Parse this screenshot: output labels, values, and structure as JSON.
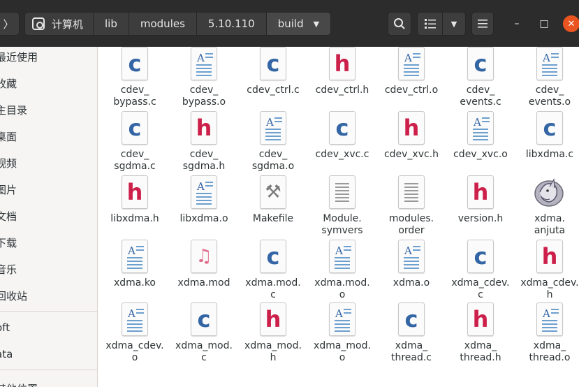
{
  "header": {
    "back_glyph": "〉",
    "breadcrumbs": [
      "计算机",
      "lib",
      "modules",
      "5.10.110",
      "build"
    ],
    "search_icon": "search-icon",
    "view_icon": "list-view-icon",
    "menu_icon": "hamburger-menu-icon",
    "window_controls": {
      "minimize": "–",
      "maximize": "□",
      "close": "✕"
    },
    "colors": {
      "bar": "#2c2c2c",
      "close": "#e95420"
    }
  },
  "sidebar": {
    "items": [
      "最近使用",
      "收藏",
      "主目录",
      "桌面",
      "视频",
      "图片",
      "文档",
      "下载",
      "音乐",
      "回收站",
      "oft",
      "ata",
      "其他位置"
    ]
  },
  "files": [
    {
      "label": "cdev_\nbypass.c",
      "type": "c"
    },
    {
      "label": "cdev_\nbypass.o",
      "type": "o"
    },
    {
      "label": "cdev_ctrl.c",
      "type": "c"
    },
    {
      "label": "cdev_ctrl.h",
      "type": "h"
    },
    {
      "label": "cdev_ctrl.o",
      "type": "o"
    },
    {
      "label": "cdev_\nevents.c",
      "type": "c"
    },
    {
      "label": "cdev_\nevents.o",
      "type": "o"
    },
    {
      "label": "cdev_\nsgdma.c",
      "type": "c"
    },
    {
      "label": "cdev_\nsgdma.h",
      "type": "h"
    },
    {
      "label": "cdev_\nsgdma.o",
      "type": "o"
    },
    {
      "label": "cdev_xvc.c",
      "type": "c"
    },
    {
      "label": "cdev_xvc.h",
      "type": "h"
    },
    {
      "label": "cdev_xvc.o",
      "type": "o"
    },
    {
      "label": "libxdma.c",
      "type": "c"
    },
    {
      "label": "libxdma.h",
      "type": "h"
    },
    {
      "label": "libxdma.o",
      "type": "o"
    },
    {
      "label": "Makefile",
      "type": "make"
    },
    {
      "label": "Module.\nsymvers",
      "type": "txt"
    },
    {
      "label": "modules.\norder",
      "type": "txt"
    },
    {
      "label": "version.h",
      "type": "h"
    },
    {
      "label": "xdma.\nanjuta",
      "type": "anjuta"
    },
    {
      "label": "xdma.ko",
      "type": "o"
    },
    {
      "label": "xdma.mod",
      "type": "mod"
    },
    {
      "label": "xdma.mod.\nc",
      "type": "c"
    },
    {
      "label": "xdma.mod.\no",
      "type": "o"
    },
    {
      "label": "xdma.o",
      "type": "o"
    },
    {
      "label": "xdma_cdev.\nc",
      "type": "c"
    },
    {
      "label": "xdma_cdev.\nh",
      "type": "h"
    },
    {
      "label": "xdma_cdev.\no",
      "type": "o"
    },
    {
      "label": "xdma_mod.\nc",
      "type": "c"
    },
    {
      "label": "xdma_mod.\nh",
      "type": "h"
    },
    {
      "label": "xdma_mod.\no",
      "type": "o"
    },
    {
      "label": "xdma_\nthread.c",
      "type": "c"
    },
    {
      "label": "xdma_\nthread.h",
      "type": "h"
    },
    {
      "label": "xdma_\nthread.o",
      "type": "o"
    }
  ]
}
